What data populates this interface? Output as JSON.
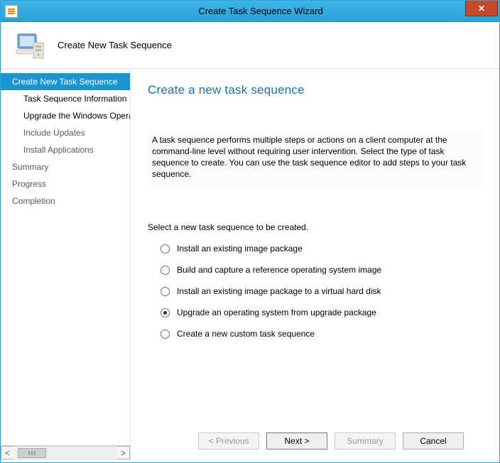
{
  "window": {
    "title": "Create Task Sequence Wizard",
    "close_glyph": "✕"
  },
  "header": {
    "text": "Create New Task Sequence"
  },
  "sidebar": {
    "items": [
      {
        "label": "Create New Task Sequence",
        "selected": true,
        "indent": false
      },
      {
        "label": "Task Sequence Information",
        "bold": true,
        "indent": true
      },
      {
        "label": "Upgrade the Windows Operating System",
        "bold": true,
        "indent": true
      },
      {
        "label": "Include Updates",
        "indent": true
      },
      {
        "label": "Install Applications",
        "indent": true
      },
      {
        "label": "Summary",
        "indent": false
      },
      {
        "label": "Progress",
        "indent": false
      },
      {
        "label": "Completion",
        "indent": false
      }
    ],
    "scroll": {
      "left": "<",
      "right": ">"
    }
  },
  "content": {
    "title": "Create a new task sequence",
    "description": "A task sequence performs multiple steps or actions on a client computer at the command-line level without requiring user intervention. Select the type of task sequence to create. You can use the task sequence editor to add steps to your task sequence.",
    "select_text": "Select a new task sequence to be created.",
    "options": [
      {
        "label": "Install an existing image package",
        "checked": false
      },
      {
        "label": "Build and capture a reference operating system image",
        "checked": false
      },
      {
        "label": "Install an existing image package to a virtual hard disk",
        "checked": false
      },
      {
        "label": "Upgrade an operating system from upgrade package",
        "checked": true
      },
      {
        "label": "Create a new custom task sequence",
        "checked": false
      }
    ]
  },
  "footer": {
    "previous": "< Previous",
    "next": "Next >",
    "summary": "Summary",
    "cancel": "Cancel"
  }
}
